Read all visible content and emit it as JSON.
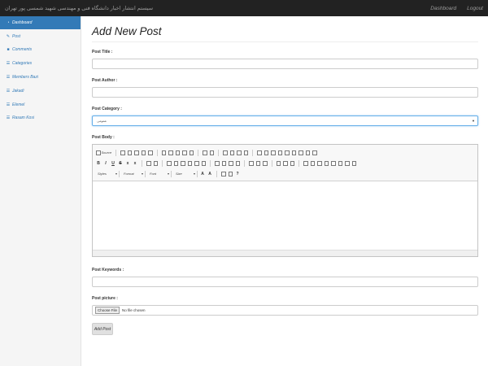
{
  "navbar": {
    "brand": "سیستم انتشار اخبار دانشگاه فنی و مهندسی شهید شمسی پور تهران",
    "links": [
      "Dashboard",
      "Logout"
    ]
  },
  "sidebar": {
    "items": [
      {
        "label": "Dashboard",
        "icon": "dashboard-icon",
        "active": true
      },
      {
        "label": "Post",
        "icon": "pencil-icon"
      },
      {
        "label": "Comments",
        "icon": "comment-icon"
      },
      {
        "label": "Categories",
        "icon": "list-icon"
      },
      {
        "label": "Members Bazi",
        "icon": "list-icon"
      },
      {
        "label": "Jakadi",
        "icon": "list-icon"
      },
      {
        "label": "Elemel",
        "icon": "list-icon"
      },
      {
        "label": "Rasam Kosi",
        "icon": "list-icon"
      }
    ]
  },
  "main": {
    "title": "Add New Post",
    "post_title_label": "Post Title :",
    "post_title_value": "",
    "post_author_label": "Post Author :",
    "post_author_value": "",
    "post_category_label": "Post Category :",
    "post_category_value": "عمومی",
    "post_body_label": "Post Body :",
    "editor": {
      "source_label": "Source",
      "combos": [
        "Styles",
        "Format",
        "Font",
        "Size"
      ]
    },
    "post_keywords_label": "Post Keywords :",
    "post_keywords_value": "",
    "post_picture_label": "Post picture :",
    "choose_file_label": "Choose File",
    "no_file_label": "No file chosen",
    "submit_label": "Add Post"
  },
  "colors": {
    "navbar": "#222222",
    "primary": "#337ab7",
    "sidebar_bg": "#f5f5f5"
  }
}
